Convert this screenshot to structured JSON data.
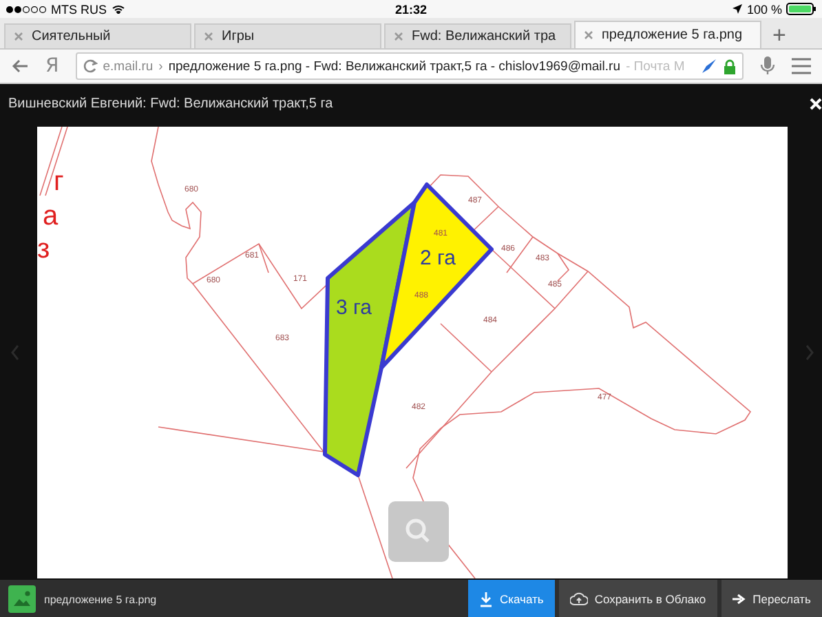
{
  "status_bar": {
    "carrier": "MTS RUS",
    "time": "21:32",
    "battery": "100 %"
  },
  "tabs": [
    {
      "label": "Сиятельный",
      "selected": false
    },
    {
      "label": "Игры",
      "selected": false
    },
    {
      "label": "Fwd: Велижанский тра",
      "selected": false
    },
    {
      "label": "предложение 5 га.png",
      "selected": true
    }
  ],
  "new_tab": "+",
  "address_bar": {
    "logo": "Я",
    "host": "e.mail.ru",
    "separator": "›",
    "page_title": "предложение 5 га.png - Fwd: Велижанский тракт,5 га - chislov1969@mail.ru",
    "faded": "- Почта М"
  },
  "viewer": {
    "title": "Вишневский Евгений: Fwd: Велижанский тракт,5 га",
    "map_labels": [
      {
        "kind": "red",
        "text": "г"
      },
      {
        "kind": "red",
        "text": "а"
      },
      {
        "kind": "red",
        "text": "з"
      },
      {
        "kind": "parcel",
        "text": "680"
      },
      {
        "kind": "parcel",
        "text": "680"
      },
      {
        "kind": "parcel",
        "text": "681"
      },
      {
        "kind": "parcel",
        "text": "171"
      },
      {
        "kind": "parcel",
        "text": "683"
      },
      {
        "kind": "parcel",
        "text": "487"
      },
      {
        "kind": "parcel",
        "text": "481"
      },
      {
        "kind": "parcel",
        "text": "486"
      },
      {
        "kind": "parcel",
        "text": "483"
      },
      {
        "kind": "parcel",
        "text": "485"
      },
      {
        "kind": "parcel",
        "text": "488"
      },
      {
        "kind": "parcel",
        "text": "484"
      },
      {
        "kind": "parcel",
        "text": "482"
      },
      {
        "kind": "parcel",
        "text": "477"
      },
      {
        "kind": "area",
        "text": "3 га"
      },
      {
        "kind": "area",
        "text": "2 га"
      }
    ],
    "file_name": "предложение 5 га.png",
    "buttons": [
      {
        "label": "Скачать",
        "kind": "primary"
      },
      {
        "label": "Сохранить в Облако",
        "kind": "cloud"
      },
      {
        "label": "Переслать",
        "kind": "forward"
      }
    ]
  }
}
